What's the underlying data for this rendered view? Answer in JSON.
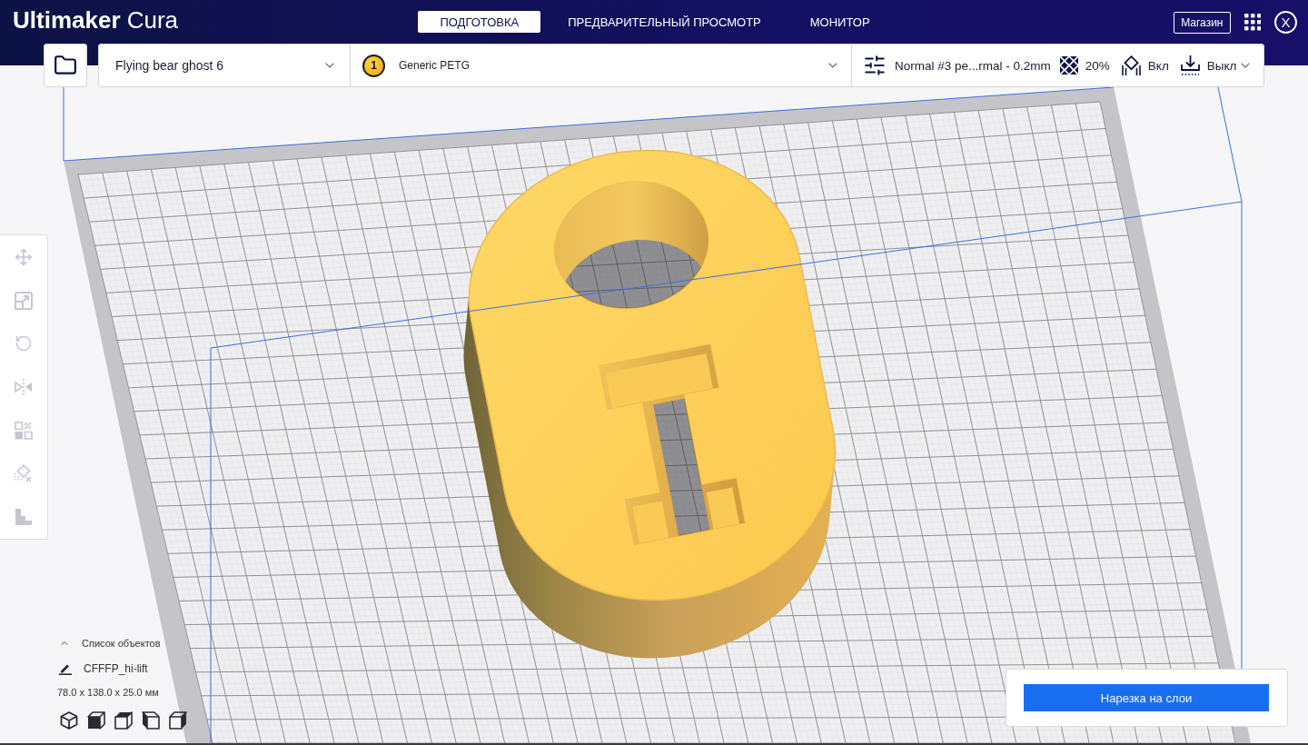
{
  "header": {
    "logo": "**Ultimaker** Cura",
    "tabs": [
      {
        "label": "ПОДГОТОВКА",
        "selected": true
      },
      {
        "label": "ПРЕДВАРИТЕЛЬНЫЙ ПРОСМОТР",
        "selected": false
      },
      {
        "label": "МОНИТОР",
        "selected": false
      }
    ],
    "marketplace_button": "Магазин",
    "account_initial": "X"
  },
  "toolbar": {
    "printer": "Flying bear ghost 6",
    "material": {
      "extruder": "1",
      "name": "Generic PETG"
    },
    "print_settings": {
      "profile": "Normal #3 pe...rmal - 0.2mm",
      "infill": "20%",
      "support": "Вкл",
      "adhesion": "Выкл"
    }
  },
  "tools": [
    {
      "kind": "move",
      "disabled": true
    },
    {
      "kind": "scale",
      "disabled": true
    },
    {
      "kind": "rotate",
      "disabled": true
    },
    {
      "kind": "mirror",
      "disabled": true
    },
    {
      "kind": "per_model_settings",
      "disabled": true
    },
    {
      "kind": "support_blocker",
      "disabled": true
    },
    {
      "kind": "steps",
      "disabled": true
    }
  ],
  "object_list": {
    "title": "Список объектов",
    "object_name": "CFFFP_hi-lift",
    "dimensions": "78.0 x 138.0 x 25.0 мм"
  },
  "view_buttons": [
    {
      "kind": "isometric"
    },
    {
      "kind": "front"
    },
    {
      "kind": "top"
    },
    {
      "kind": "left"
    },
    {
      "kind": "right"
    }
  ],
  "slice_button": "Нарезка на слои"
}
